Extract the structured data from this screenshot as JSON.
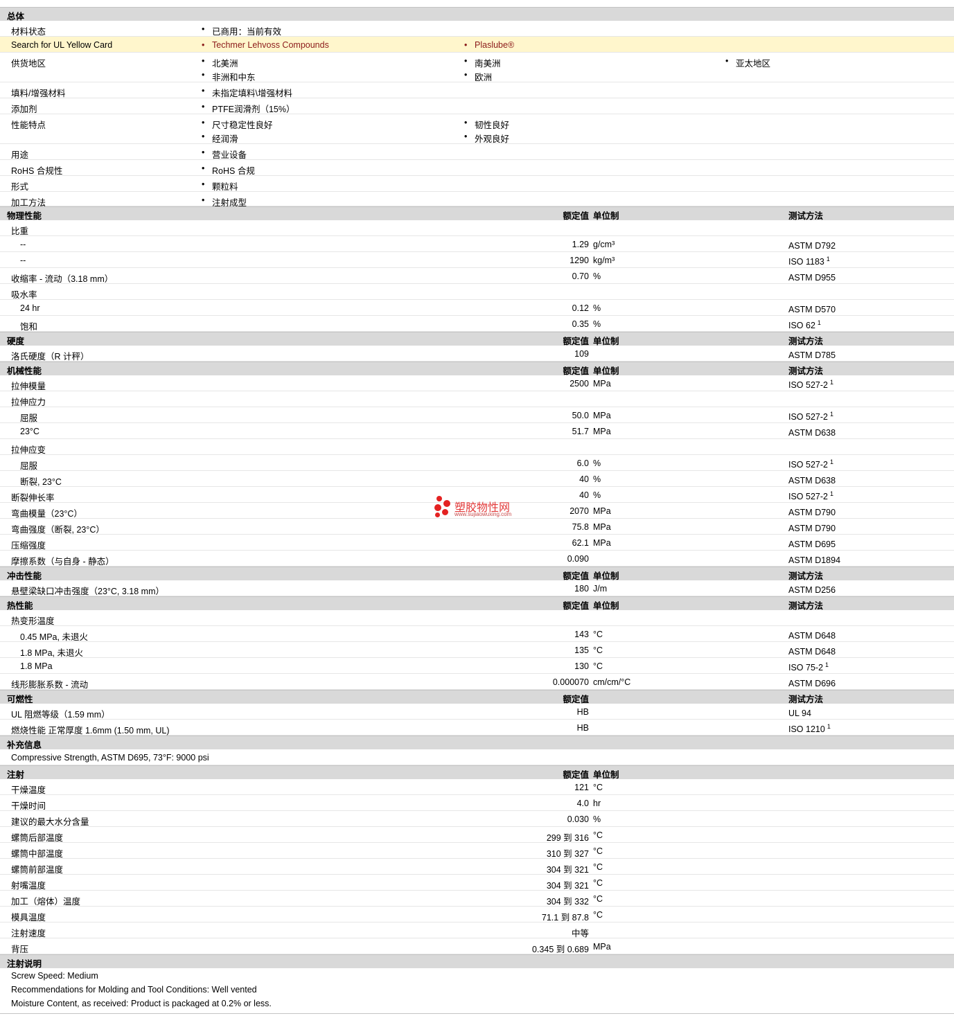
{
  "sections": {
    "general": {
      "title": "总体"
    },
    "physical": {
      "title": "物理性能",
      "h_val": "额定值",
      "h_unit": "单位制",
      "h_test": "测试方法"
    },
    "hardness": {
      "title": "硬度",
      "h_val": "额定值",
      "h_unit": "单位制",
      "h_test": "测试方法"
    },
    "mechanical": {
      "title": "机械性能",
      "h_val": "额定值",
      "h_unit": "单位制",
      "h_test": "测试方法"
    },
    "impact": {
      "title": "冲击性能",
      "h_val": "额定值",
      "h_unit": "单位制",
      "h_test": "测试方法"
    },
    "thermal": {
      "title": "热性能",
      "h_val": "额定值",
      "h_unit": "单位制",
      "h_test": "测试方法"
    },
    "flammability": {
      "title": "可燃性",
      "h_val": "额定值",
      "h_test": "测试方法"
    },
    "supplemental": {
      "title": "补充信息"
    },
    "injection": {
      "title": "注射",
      "h_val": "额定值",
      "h_unit": "单位制"
    },
    "injection_notes": {
      "title": "注射说明"
    }
  },
  "general": {
    "status": {
      "label": "材料状态",
      "items": [
        "已商用：当前有效"
      ]
    },
    "ul": {
      "label": "Search for UL Yellow Card",
      "items": [
        "Techmer Lehvoss Compounds",
        "Plaslube®"
      ]
    },
    "region": {
      "label": "供货地区",
      "items": [
        "北美洲",
        "南美洲",
        "亚太地区",
        "非洲和中东",
        "欧洲"
      ]
    },
    "filler": {
      "label": "填料/增强材料",
      "items": [
        "未指定填料\\增强材料"
      ]
    },
    "additive": {
      "label": "添加剂",
      "items": [
        "PTFE润滑剂（15%）"
      ]
    },
    "features": {
      "label": "性能特点",
      "items": [
        "尺寸稳定性良好",
        "韧性良好",
        "经润滑",
        "外观良好"
      ]
    },
    "uses": {
      "label": "用途",
      "items": [
        "营业设备"
      ]
    },
    "rohs": {
      "label": "RoHS 合规性",
      "items": [
        "RoHS 合规"
      ]
    },
    "form": {
      "label": "形式",
      "items": [
        "颗粒料"
      ]
    },
    "method": {
      "label": "加工方法",
      "items": [
        "注射成型"
      ]
    }
  },
  "physical": [
    {
      "label": "比重",
      "val": "",
      "unit": "",
      "test": "",
      "sup": ""
    },
    {
      "label": "--",
      "val": "1.29",
      "unit": "g/cm³",
      "test": "ASTM D792",
      "sup": ""
    },
    {
      "label": "--",
      "val": "1290",
      "unit": "kg/m³",
      "test": "ISO 1183",
      "sup": "1"
    },
    {
      "label": "收缩率 - 流动（3.18 mm）",
      "val": "0.70",
      "unit": "%",
      "test": "ASTM D955",
      "sup": ""
    },
    {
      "label": "吸水率",
      "val": "",
      "unit": "",
      "test": "",
      "sup": ""
    },
    {
      "label": "24 hr",
      "val": "0.12",
      "unit": "%",
      "test": "ASTM D570",
      "sup": ""
    },
    {
      "label": "饱和",
      "val": "0.35",
      "unit": "%",
      "test": "ISO 62",
      "sup": "1"
    }
  ],
  "hardness": [
    {
      "label": "洛氏硬度（R 计秤）",
      "val": "109",
      "unit": "",
      "test": "ASTM D785",
      "sup": ""
    }
  ],
  "mechanical": [
    {
      "label": "拉伸模量",
      "val": "2500",
      "unit": "MPa",
      "test": "ISO 527-2",
      "sup": "1"
    },
    {
      "label": "拉伸应力",
      "val": "",
      "unit": "",
      "test": "",
      "sup": ""
    },
    {
      "label": "屈服",
      "val": "50.0",
      "unit": "MPa",
      "test": "ISO 527-2",
      "sup": "1"
    },
    {
      "label": "23°C",
      "val": "51.7",
      "unit": "MPa",
      "test": "ASTM D638",
      "sup": ""
    },
    {
      "label": "拉伸应变",
      "val": "",
      "unit": "",
      "test": "",
      "sup": ""
    },
    {
      "label": "屈服",
      "val": "6.0",
      "unit": "%",
      "test": "ISO 527-2",
      "sup": "1"
    },
    {
      "label": "断裂, 23°C",
      "val": "40",
      "unit": "%",
      "test": "ASTM D638",
      "sup": ""
    },
    {
      "label": "断裂伸长率",
      "val": "40",
      "unit": "%",
      "test": "ISO 527-2",
      "sup": "1"
    },
    {
      "label": "弯曲模量（23°C）",
      "val": "2070",
      "unit": "MPa",
      "test": "ASTM D790",
      "sup": ""
    },
    {
      "label": "弯曲强度（断裂, 23°C）",
      "val": "75.8",
      "unit": "MPa",
      "test": "ASTM D790",
      "sup": ""
    },
    {
      "label": "压缩强度",
      "val": "62.1",
      "unit": "MPa",
      "test": "ASTM D695",
      "sup": ""
    },
    {
      "label": "摩擦系数（与自身 - 静态）",
      "val": "0.090",
      "unit": "",
      "test": "ASTM D1894",
      "sup": ""
    }
  ],
  "impact": [
    {
      "label": "悬壁梁缺口冲击强度（23°C, 3.18 mm）",
      "val": "180",
      "unit": "J/m",
      "test": "ASTM D256",
      "sup": ""
    }
  ],
  "thermal": [
    {
      "label": "热变形温度",
      "val": "",
      "unit": "",
      "test": "",
      "sup": ""
    },
    {
      "label": "0.45 MPa, 未退火",
      "val": "143",
      "unit": "°C",
      "test": "ASTM D648",
      "sup": ""
    },
    {
      "label": "1.8 MPa, 未退火",
      "val": "135",
      "unit": "°C",
      "test": "ASTM D648",
      "sup": ""
    },
    {
      "label": "1.8 MPa",
      "val": "130",
      "unit": "°C",
      "test": "ISO 75-2",
      "sup": "1"
    },
    {
      "label": "线形膨胀系数 - 流动",
      "val": "0.000070",
      "unit": "cm/cm/°C",
      "test": "ASTM D696",
      "sup": ""
    }
  ],
  "flammability": [
    {
      "label": "UL 阻燃等级（1.59 mm）",
      "val": "HB",
      "unit": "",
      "test": "UL 94",
      "sup": ""
    },
    {
      "label": "燃烧性能 正常厚度 1.6mm (1.50 mm, UL)",
      "val": "HB",
      "unit": "",
      "test": "ISO 1210",
      "sup": "1"
    }
  ],
  "supplemental": [
    "Compressive Strength, ASTM D695, 73°F: 9000 psi"
  ],
  "injection": [
    {
      "label": "干燥温度",
      "val": "121",
      "unit": "°C"
    },
    {
      "label": "干燥时间",
      "val": "4.0",
      "unit": "hr"
    },
    {
      "label": "建议的最大水分含量",
      "val": "0.030",
      "unit": "%"
    },
    {
      "label": "螺筒后部温度",
      "val": "299 到 316",
      "unit": "°C"
    },
    {
      "label": "螺筒中部温度",
      "val": "310 到 327",
      "unit": "°C"
    },
    {
      "label": "螺筒前部温度",
      "val": "304 到 321",
      "unit": "°C"
    },
    {
      "label": "射嘴温度",
      "val": "304 到 321",
      "unit": "°C"
    },
    {
      "label": "加工（熔体）温度",
      "val": "304 到 332",
      "unit": "°C"
    },
    {
      "label": "模具温度",
      "val": "71.1 到 87.8",
      "unit": "°C"
    },
    {
      "label": "注射速度",
      "val": "中等",
      "unit": ""
    },
    {
      "label": "背压",
      "val": "0.345 到 0.689",
      "unit": "MPa"
    }
  ],
  "injection_notes": [
    "Screw Speed: Medium",
    "Recommendations for Molding and Tool Conditions: Well vented",
    "Moisture Content, as received: Product is packaged at 0.2% or less."
  ],
  "watermark": {
    "zh": "塑胶物性网",
    "en": "www.sujiaowuxing.com"
  },
  "colors": {
    "section_bg": "#d9d9d9",
    "highlight_bg": "#fff6cc",
    "link": "#8b1a1a",
    "watermark": "#e42222"
  }
}
